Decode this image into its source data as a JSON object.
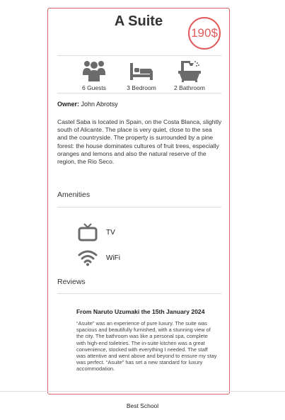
{
  "listing": {
    "title": "A Suite",
    "price": "190$",
    "features": [
      {
        "icon": "guests-icon",
        "label": "6 Guests"
      },
      {
        "icon": "bed-icon",
        "label": "3 Bedroom"
      },
      {
        "icon": "bathtub-icon",
        "label": "2 Bathroom"
      }
    ],
    "owner_label": "Owner:",
    "owner_name": "John Abrotsy",
    "description": "Castel Saba is located in Spain, on the Costa Blanca, slightly south of Alicante. The place is very quiet, close to the sea and the countryside. The property is surrounded by a pine forest: the house dominates cultures of fruit trees, especially oranges and lemons and also the natural reserve of the region, the Rio Seco."
  },
  "amenities": {
    "title": "Amenities",
    "items": [
      {
        "icon": "tv-icon",
        "label": "TV"
      },
      {
        "icon": "wifi-icon",
        "label": "WiFi"
      }
    ]
  },
  "reviews": {
    "title": "Reviews",
    "items": [
      {
        "heading": "From Naruto Uzumaki the 15th January 2024",
        "text": "“Asuite” was an experience of pure luxury. The suite was spacious and beautifully furnished, with a stunning view of the city. The bathroom was like a personal spa, complete with high-end toiletries. The in-suite kitchen was a great convenience, stocked with everything I needed. The staff was attentive and went above and beyond to ensure my stay was perfect. “Asuite” has set a new standard for luxury accommodation."
      }
    ]
  },
  "footer": {
    "text": "Best School"
  },
  "colors": {
    "accent": "#e25a5a",
    "icon": "#6b6b6b"
  }
}
